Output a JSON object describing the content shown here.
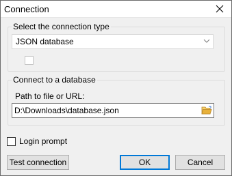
{
  "window": {
    "title": "Connection",
    "close_icon": "close-icon"
  },
  "connection_type": {
    "legend": "Select the connection type",
    "selected": "JSON database",
    "checkbox_checked": false,
    "checkbox_enabled": false
  },
  "database": {
    "legend": "Connect to a database",
    "path_label": "Path to file or URL:",
    "path_value": "D:\\Downloads\\database.json",
    "browse_icon": "folder-open-icon"
  },
  "login_prompt": {
    "label": "Login prompt",
    "checked": false
  },
  "buttons": {
    "test": "Test connection",
    "ok": "OK",
    "cancel": "Cancel"
  },
  "colors": {
    "default_button_border": "#0078d7",
    "folder_icon": "#e8b13a"
  }
}
